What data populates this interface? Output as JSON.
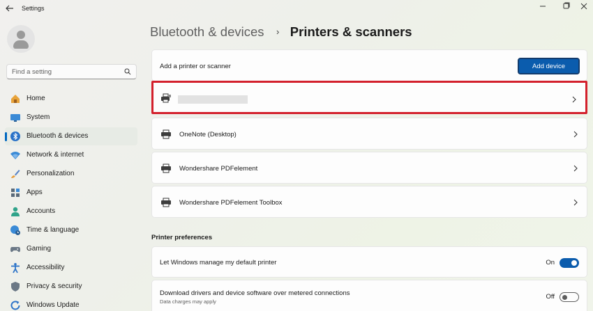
{
  "window": {
    "title": "Settings"
  },
  "search": {
    "placeholder": "Find a setting"
  },
  "sidebar": {
    "items": [
      {
        "label": "Home",
        "icon": "home-icon"
      },
      {
        "label": "System",
        "icon": "monitor-icon"
      },
      {
        "label": "Bluetooth & devices",
        "icon": "bluetooth-icon",
        "active": true
      },
      {
        "label": "Network & internet",
        "icon": "wifi-icon"
      },
      {
        "label": "Personalization",
        "icon": "brush-icon"
      },
      {
        "label": "Apps",
        "icon": "apps-icon"
      },
      {
        "label": "Accounts",
        "icon": "person-icon"
      },
      {
        "label": "Time & language",
        "icon": "globe-clock-icon"
      },
      {
        "label": "Gaming",
        "icon": "gamepad-icon"
      },
      {
        "label": "Accessibility",
        "icon": "accessibility-icon"
      },
      {
        "label": "Privacy & security",
        "icon": "shield-icon"
      },
      {
        "label": "Windows Update",
        "icon": "update-icon"
      }
    ]
  },
  "breadcrumb": {
    "parent": "Bluetooth & devices",
    "separator": "›",
    "current": "Printers & scanners"
  },
  "add_printer": {
    "label": "Add a printer or scanner",
    "button": "Add device"
  },
  "printers": [
    {
      "name": "",
      "redacted": true,
      "highlighted": true
    },
    {
      "name": "OneNote (Desktop)"
    },
    {
      "name": "Wondershare PDFelement"
    },
    {
      "name": "Wondershare PDFelement Toolbox"
    }
  ],
  "preferences": {
    "heading": "Printer preferences",
    "manage_default": {
      "label": "Let Windows manage my default printer",
      "state": "On",
      "value": true
    },
    "metered": {
      "label": "Download drivers and device software over metered connections",
      "sublabel": "Data charges may apply",
      "state": "Off",
      "value": false
    }
  },
  "colors": {
    "accent": "#0b5cad",
    "highlight_border": "#d3202c"
  }
}
